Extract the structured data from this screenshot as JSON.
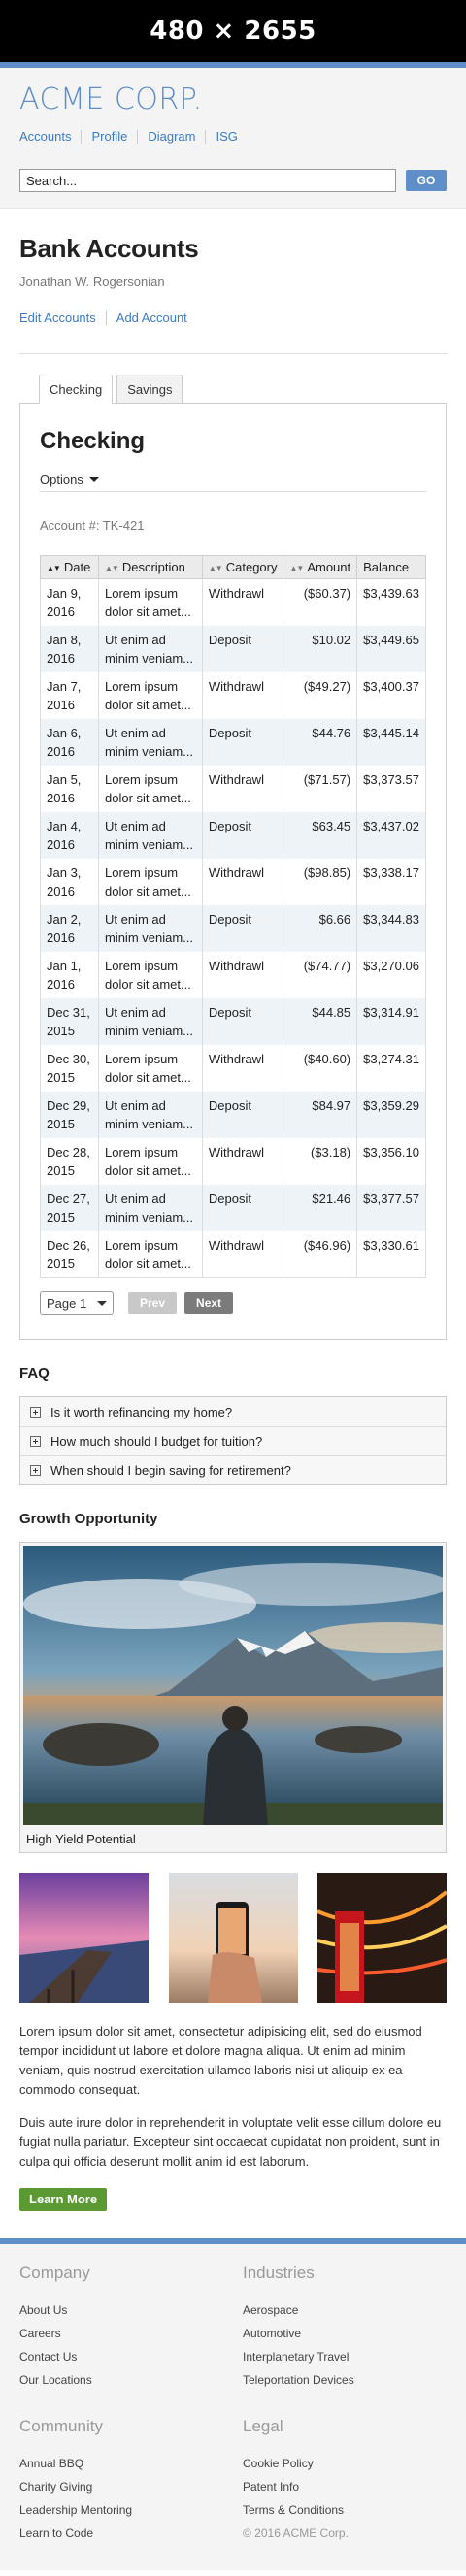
{
  "banner": {
    "text": "480 × 2655"
  },
  "header": {
    "logo": "ACME CORP.",
    "nav": [
      "Accounts",
      "Profile",
      "Diagram",
      "ISG"
    ],
    "search": {
      "placeholder": "Search...",
      "button": "GO"
    }
  },
  "page": {
    "title": "Bank Accounts",
    "owner": "Jonathan W. Rogersonian",
    "actions": [
      "Edit Accounts",
      "Add Account"
    ]
  },
  "tabs": [
    "Checking",
    "Savings"
  ],
  "account": {
    "heading": "Checking",
    "options_label": "Options",
    "account_number": "Account #: TK-421",
    "columns": [
      "Date",
      "Description",
      "Category",
      "Amount",
      "Balance"
    ],
    "rows": [
      {
        "date": "Jan 9, 2016",
        "desc": "Lorem ipsum dolor sit amet...",
        "cat": "Withdrawl",
        "amount": "($60.37)",
        "balance": "$3,439.63",
        "neg": true
      },
      {
        "date": "Jan 8, 2016",
        "desc": "Ut enim ad minim veniam...",
        "cat": "Deposit",
        "amount": "$10.02",
        "balance": "$3,449.65",
        "neg": false
      },
      {
        "date": "Jan 7, 2016",
        "desc": "Lorem ipsum dolor sit amet...",
        "cat": "Withdrawl",
        "amount": "($49.27)",
        "balance": "$3,400.37",
        "neg": true
      },
      {
        "date": "Jan 6, 2016",
        "desc": "Ut enim ad minim veniam...",
        "cat": "Deposit",
        "amount": "$44.76",
        "balance": "$3,445.14",
        "neg": false
      },
      {
        "date": "Jan 5, 2016",
        "desc": "Lorem ipsum dolor sit amet...",
        "cat": "Withdrawl",
        "amount": "($71.57)",
        "balance": "$3,373.57",
        "neg": true
      },
      {
        "date": "Jan 4, 2016",
        "desc": "Ut enim ad minim veniam...",
        "cat": "Deposit",
        "amount": "$63.45",
        "balance": "$3,437.02",
        "neg": false
      },
      {
        "date": "Jan 3, 2016",
        "desc": "Lorem ipsum dolor sit amet...",
        "cat": "Withdrawl",
        "amount": "($98.85)",
        "balance": "$3,338.17",
        "neg": true
      },
      {
        "date": "Jan 2, 2016",
        "desc": "Ut enim ad minim veniam...",
        "cat": "Deposit",
        "amount": "$6.66",
        "balance": "$3,344.83",
        "neg": false
      },
      {
        "date": "Jan 1, 2016",
        "desc": "Lorem ipsum dolor sit amet...",
        "cat": "Withdrawl",
        "amount": "($74.77)",
        "balance": "$3,270.06",
        "neg": true
      },
      {
        "date": "Dec 31, 2015",
        "desc": "Ut enim ad minim veniam...",
        "cat": "Deposit",
        "amount": "$44.85",
        "balance": "$3,314.91",
        "neg": false
      },
      {
        "date": "Dec 30, 2015",
        "desc": "Lorem ipsum dolor sit amet...",
        "cat": "Withdrawl",
        "amount": "($40.60)",
        "balance": "$3,274.31",
        "neg": true
      },
      {
        "date": "Dec 29, 2015",
        "desc": "Ut enim ad minim veniam...",
        "cat": "Deposit",
        "amount": "$84.97",
        "balance": "$3,359.29",
        "neg": false
      },
      {
        "date": "Dec 28, 2015",
        "desc": "Lorem ipsum dolor sit amet...",
        "cat": "Withdrawl",
        "amount": "($3.18)",
        "balance": "$3,356.10",
        "neg": true
      },
      {
        "date": "Dec 27, 2015",
        "desc": "Ut enim ad minim veniam...",
        "cat": "Deposit",
        "amount": "$21.46",
        "balance": "$3,377.57",
        "neg": false
      },
      {
        "date": "Dec 26, 2015",
        "desc": "Lorem ipsum dolor sit amet...",
        "cat": "Withdrawl",
        "amount": "($46.96)",
        "balance": "$3,330.61",
        "neg": true
      }
    ],
    "pager": {
      "page_select": "Page 1",
      "prev": "Prev",
      "next": "Next"
    }
  },
  "faq": {
    "title": "FAQ",
    "items": [
      "Is it worth refinancing my home?",
      "How much should I budget for tuition?",
      "When should I begin saving for retirement?"
    ]
  },
  "growth": {
    "title": "Growth Opportunity",
    "caption": "High Yield Potential"
  },
  "body_text": [
    "Lorem ipsum dolor sit amet, consectetur adipisicing elit, sed do eiusmod tempor incididunt ut labore et dolore magna aliqua. Ut enim ad minim veniam, quis nostrud exercitation ullamco laboris nisi ut aliquip ex ea commodo consequat.",
    "Duis aute irure dolor in reprehenderit in voluptate velit esse cillum dolore eu fugiat nulla pariatur. Excepteur sint occaecat cupidatat non proident, sunt in culpa qui officia deserunt mollit anim id est laborum."
  ],
  "cta": "Learn More",
  "footer": {
    "columns": [
      {
        "title": "Company",
        "links": [
          "About Us",
          "Careers",
          "Contact Us",
          "Our Locations"
        ]
      },
      {
        "title": "Industries",
        "links": [
          "Aerospace",
          "Automotive",
          "Interplanetary Travel",
          "Teleportation Devices"
        ]
      },
      {
        "title": "Community",
        "links": [
          "Annual BBQ",
          "Charity Giving",
          "Leadership Mentoring",
          "Learn to Code"
        ]
      },
      {
        "title": "Legal",
        "links": [
          "Cookie Policy",
          "Patent Info",
          "Terms & Conditions"
        ]
      }
    ],
    "copyright": "© 2016 ACME Corp."
  },
  "colors": {
    "accent": "#5e8fc8",
    "link": "#3a7bc8",
    "negative": "#c4272c",
    "cta": "#5b9a33"
  }
}
